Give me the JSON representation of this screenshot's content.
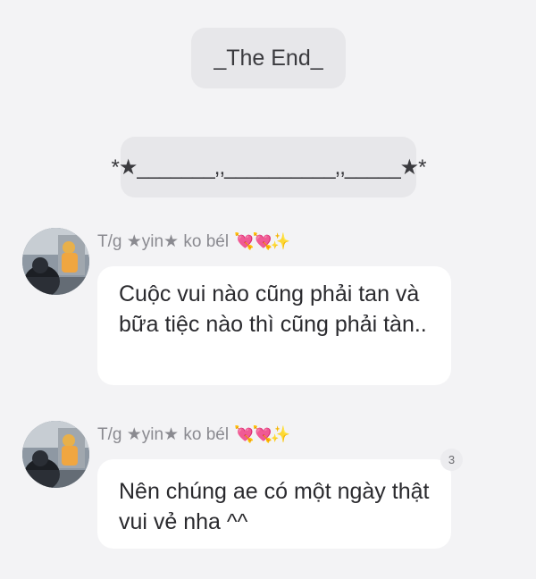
{
  "system_messages": {
    "the_end": "_The End_",
    "divider": "*★_______,,__________,,_____★*"
  },
  "messages": [
    {
      "author": "T/g ★yin★ ko bél",
      "author_decoration": "💘💘✨",
      "text": "Cuộc vui nào cũng phải tan và bữa tiệc nào thì cũng phải tàn.."
    },
    {
      "author": "T/g ★yin★ ko bél",
      "author_decoration": "💘💘✨",
      "text": "Nên chúng ae có một ngày thật vui vẻ nha ^^",
      "reaction_count": "3"
    }
  ]
}
